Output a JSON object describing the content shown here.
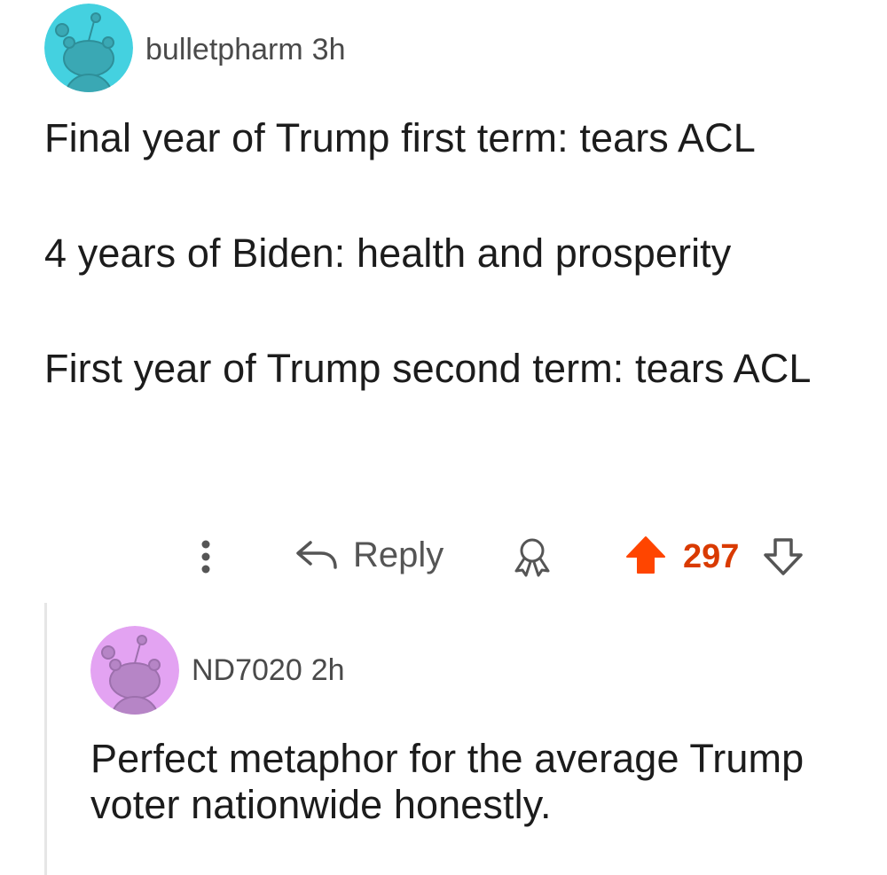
{
  "comment": {
    "username": "bulletpharm",
    "age": "3h",
    "avatar_color": "#44d1e0",
    "paragraphs": [
      "Final year of Trump first term: tears ACL",
      "4 years of Biden: health and prosperity",
      "First year of Trump second term: tears ACL"
    ],
    "actions": {
      "more_icon": "vertical-dots-icon",
      "reply_label": "Reply",
      "award_icon": "award-icon",
      "score": "297",
      "upvote_color": "#ff4500",
      "score_color": "#d93a00"
    }
  },
  "reply": {
    "username": "ND7020",
    "age": "2h",
    "avatar_color": "#e3a3f2",
    "text": "Perfect metaphor for the average Trump voter nationwide honestly."
  }
}
